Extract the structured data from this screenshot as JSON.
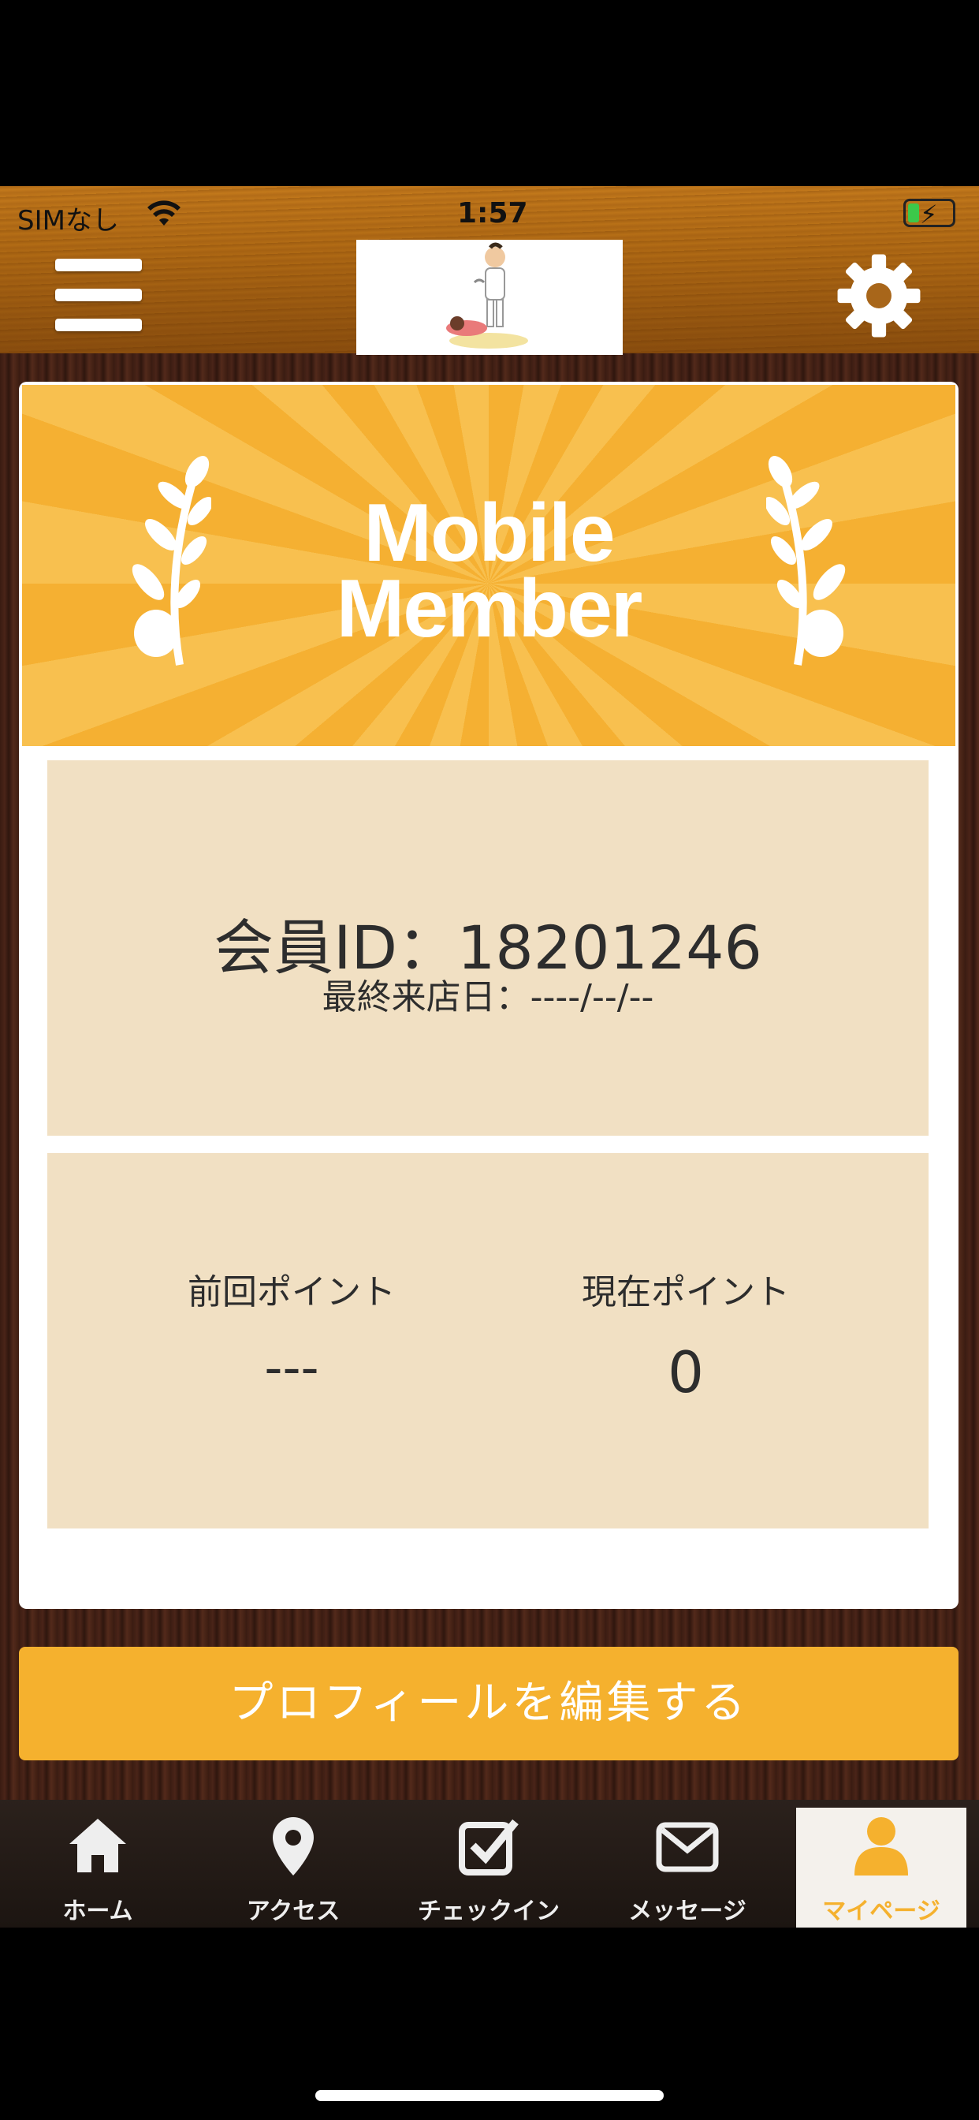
{
  "status_bar": {
    "carrier": "SIMなし",
    "time": "1:57"
  },
  "header": {
    "menu_icon": "hamburger-menu-icon",
    "settings_icon": "gear-icon"
  },
  "card": {
    "banner_title_line1": "Mobile",
    "banner_title_line2": "Member",
    "member_id_text": "会員ID：18201246",
    "last_visit_text": "最終来店日：----/--/--",
    "previous_points_label": "前回ポイント",
    "previous_points_value": "---",
    "current_points_label": "現在ポイント",
    "current_points_value": "0"
  },
  "edit_profile_button": "プロフィールを編集する",
  "tabs": [
    {
      "label": "ホーム",
      "icon": "home-icon"
    },
    {
      "label": "アクセス",
      "icon": "map-pin-icon"
    },
    {
      "label": "チェックイン",
      "icon": "checkbox-icon"
    },
    {
      "label": "メッセージ",
      "icon": "envelope-icon"
    },
    {
      "label": "マイページ",
      "icon": "person-icon"
    }
  ],
  "colors": {
    "accent": "#F5B12E",
    "panel": "#F1E0C3",
    "text": "#2D2D2D"
  }
}
